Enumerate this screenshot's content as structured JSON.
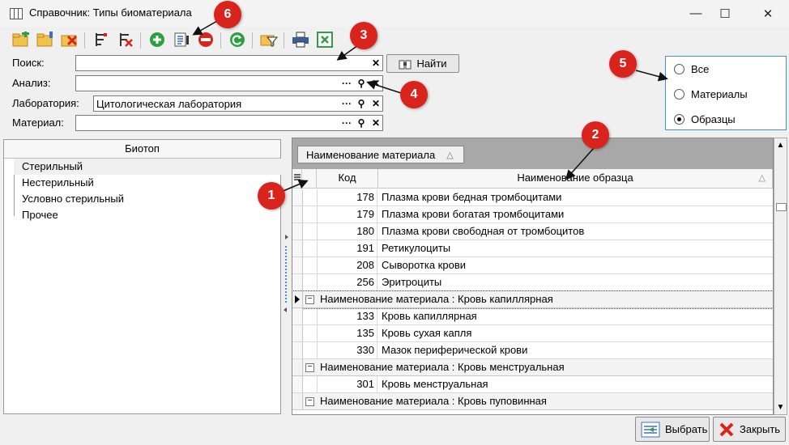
{
  "window": {
    "title": "Справочник: Типы биоматериала",
    "minimize": "—",
    "maximize": "☐",
    "close": "✕"
  },
  "filters": {
    "search_label": "Поиск:",
    "search_value": "",
    "analysis_label": "Анализ:",
    "analysis_value": "",
    "lab_label": "Лаборатория:",
    "lab_value": "Цитологическая лаборатория",
    "material_label": "Материал:",
    "material_value": "",
    "find_button": "Найти",
    "dots": "···",
    "clear": "✕"
  },
  "radio": {
    "options": [
      "Все",
      "Материалы",
      "Образцы"
    ],
    "selected": "Образцы"
  },
  "left_panel": {
    "header": "Биотоп",
    "items": [
      "Стерильный",
      "Нестерильный",
      "Условно стерильный",
      "Прочее"
    ]
  },
  "grid": {
    "group_chip": "Наименование материала",
    "col_code": "Код",
    "col_name": "Наименование образца",
    "sort_glyph": "△",
    "rows_a": [
      {
        "code": "178",
        "name": "Плазма крови бедная тромбоцитами"
      },
      {
        "code": "179",
        "name": "Плазма крови богатая тромбоцитами"
      },
      {
        "code": "180",
        "name": "Плазма крови свободная от тромбоцитов"
      },
      {
        "code": "191",
        "name": "Ретикулоциты"
      },
      {
        "code": "208",
        "name": "Сыворотка крови"
      },
      {
        "code": "256",
        "name": "Эритроциты"
      }
    ],
    "group1": "Наименование материала : Кровь капиллярная",
    "rows_b": [
      {
        "code": "133",
        "name": "Кровь капиллярная"
      },
      {
        "code": "135",
        "name": "Кровь сухая капля"
      },
      {
        "code": "330",
        "name": "Мазок периферической крови"
      }
    ],
    "group2": "Наименование материала : Кровь менструальная",
    "rows_c": [
      {
        "code": "301",
        "name": "Кровь менструальная"
      }
    ],
    "group3": "Наименование материала : Кровь пуповинная",
    "toggle": "−"
  },
  "buttons": {
    "select": "Выбрать",
    "close": "Закрыть"
  },
  "markers": [
    "1",
    "2",
    "3",
    "4",
    "5",
    "6"
  ],
  "colors": {
    "marker": "#d9231d",
    "accent": "#4a90d0",
    "add": "#2ea043",
    "delete": "#d9231d"
  }
}
